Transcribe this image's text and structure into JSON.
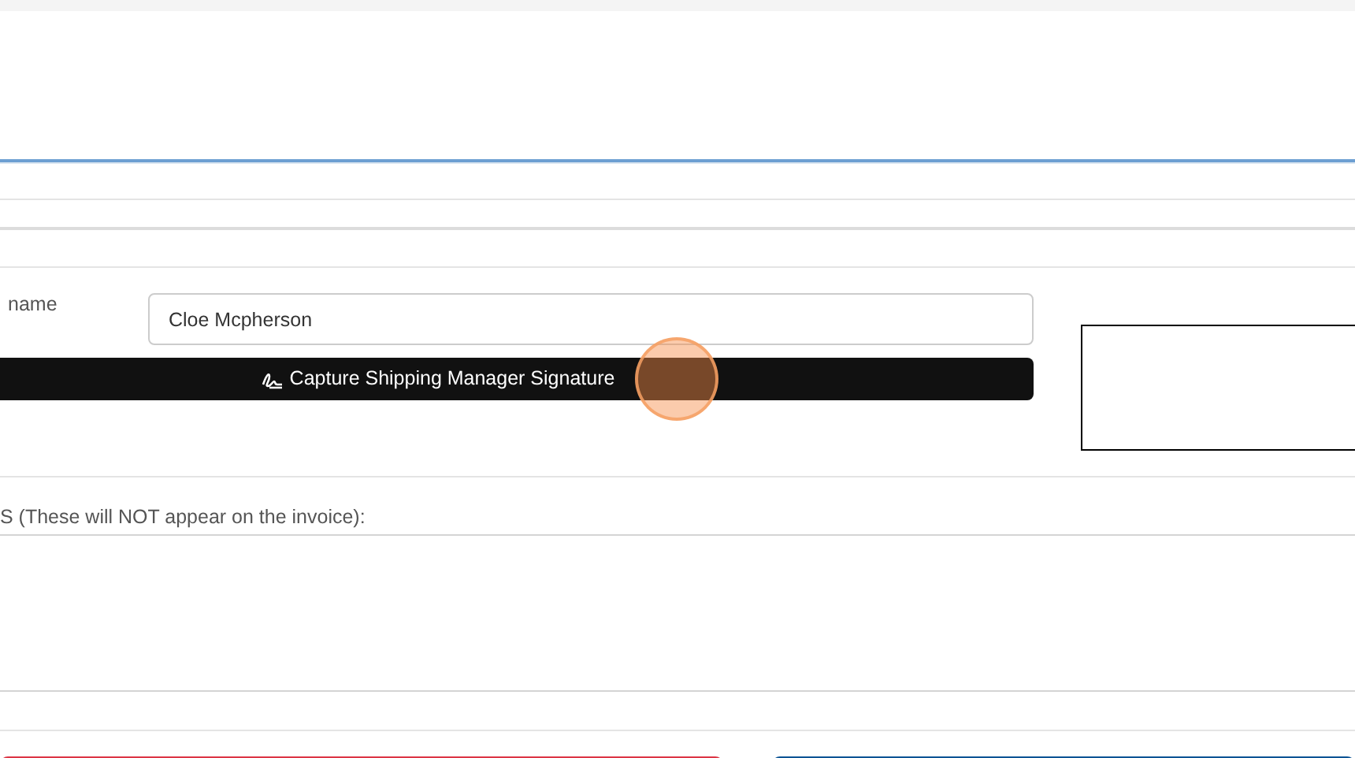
{
  "shipping_manager": {
    "label": "name",
    "value": "Cloe Mcpherson"
  },
  "capture_button": {
    "label": "Capture Shipping Manager Signature"
  },
  "notes": {
    "label": "S (These will NOT appear on the invoice):"
  },
  "action_buttons": [
    {
      "color": "#dc3545"
    },
    {
      "color": "#0b5394"
    }
  ]
}
